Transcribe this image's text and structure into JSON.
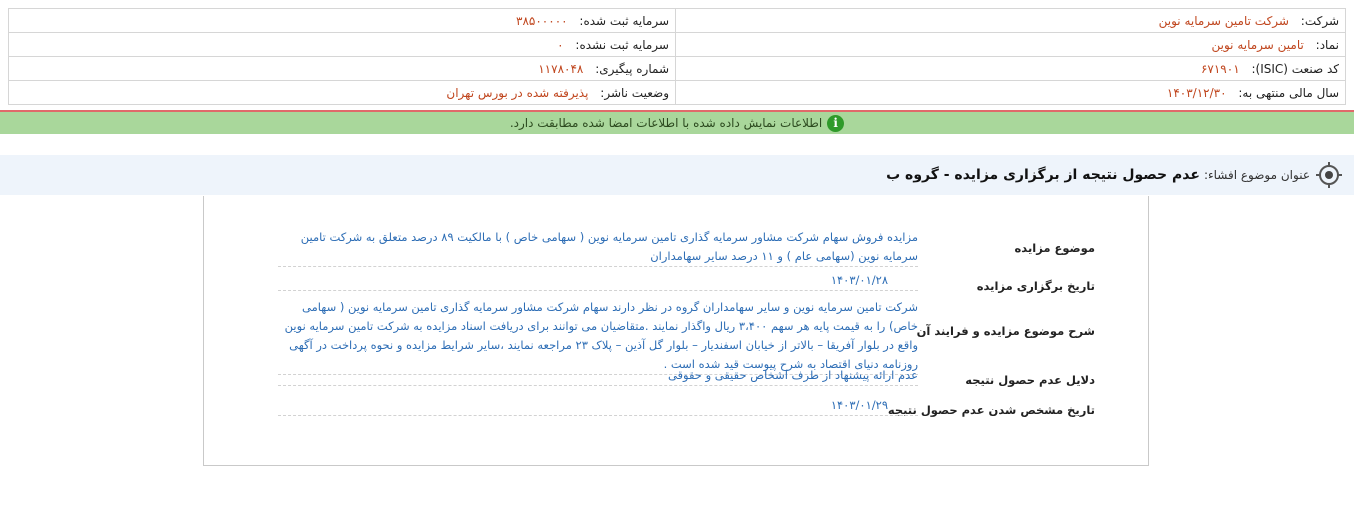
{
  "company_info": {
    "company_label": "شرکت:",
    "company_value": "شرکت تامین سرمایه نوین",
    "symbol_label": "نماد:",
    "symbol_value": "تامین سرمایه نوین",
    "isic_label": "کد صنعت (ISIC):",
    "isic_value": "۶۷۱۹۰۱",
    "fiscal_label": "سال مالی منتهی به:",
    "fiscal_value": "۱۴۰۳/۱۲/۳۰",
    "reg_capital_label": "سرمایه ثبت شده:",
    "reg_capital_value": "۳۸۵۰۰۰۰۰",
    "unreg_capital_label": "سرمایه ثبت نشده:",
    "unreg_capital_value": "۰",
    "tracking_label": "شماره پیگیری:",
    "tracking_value": "۱۱۷۸۰۴۸",
    "publisher_status_label": "وضعیت ناشر:",
    "publisher_status_value": "پذیرفته شده در بورس تهران"
  },
  "notice": {
    "icon": "info-icon",
    "text": "اطلاعات نمایش داده شده با اطلاعات امضا شده مطابقت دارد."
  },
  "subject": {
    "icon": "target-icon",
    "label": "عنوان موضوع افشاء:",
    "title": "عدم حصول نتیجه از برگزاری مزایده - گروه ب"
  },
  "details": [
    {
      "label": "موضوع مزایده",
      "value": "مزایده فروش سهام شرکت مشاور سرمایه گذاری تامین سرمایه نوین ( سهامی خاص ) با مالکیت ۸۹ درصد متعلق به شرکت تامین سرمایه نوین (سهامی عام ) و ۱۱ درصد سایر سهامداران"
    },
    {
      "label": "تاریخ برگزاری مزایده",
      "value": "۱۴۰۳/۰۱/۲۸"
    },
    {
      "label": "شرح موضوع مزایده و فرایند آن",
      "value": "شرکت تامین سرمایه نوین و سایر سهامداران گروه در نظر دارند سهام شرکت مشاور سرمایه گذاری تامین سرمایه نوین ( سهامی خاص) را به قیمت پایه هر سهم ۳،۴۰۰ ریال واگذار نمایند .متقاضیان می توانند برای دریافت اسناد مزایده به شرکت تامین سرمایه نوین واقع در بلوار آفریقا – بالاتر از خیابان اسفندیار – بلوار گل آذین – پلاک ۲۳ مراجعه نمایند ،سایر شرایط مزایده و نحوه پرداخت در آگهی روزنامه دنیای اقتصاد به شرح پیوست قید شده است ."
    },
    {
      "label": "دلایل عدم حصول نتیجه",
      "value": "عدم ارائه پیشنهاد از طرف اشخاص حقیقی و حقوقی"
    },
    {
      "label": "تاریخ مشخص شدن عدم حصول نتیجه",
      "value": "۱۴۰۳/۰۱/۲۹"
    }
  ]
}
